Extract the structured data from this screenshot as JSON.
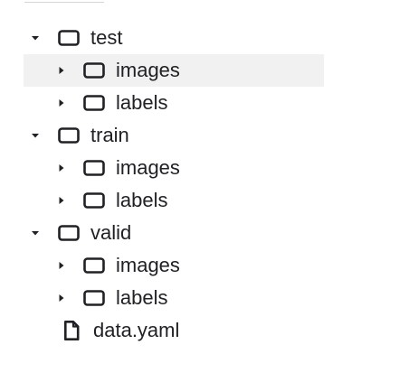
{
  "tree": {
    "items": [
      {
        "label": "test"
      },
      {
        "label": "images"
      },
      {
        "label": "labels"
      },
      {
        "label": "train"
      },
      {
        "label": "images"
      },
      {
        "label": "labels"
      },
      {
        "label": "valid"
      },
      {
        "label": "images"
      },
      {
        "label": "labels"
      },
      {
        "label": "data.yaml"
      }
    ]
  },
  "icons": {
    "expanded": "caret-down-icon",
    "collapsed": "caret-right-icon",
    "folder": "folder-icon",
    "file": "file-icon"
  },
  "colors": {
    "selected_row": "#f1f1f1",
    "text": "#202124"
  }
}
